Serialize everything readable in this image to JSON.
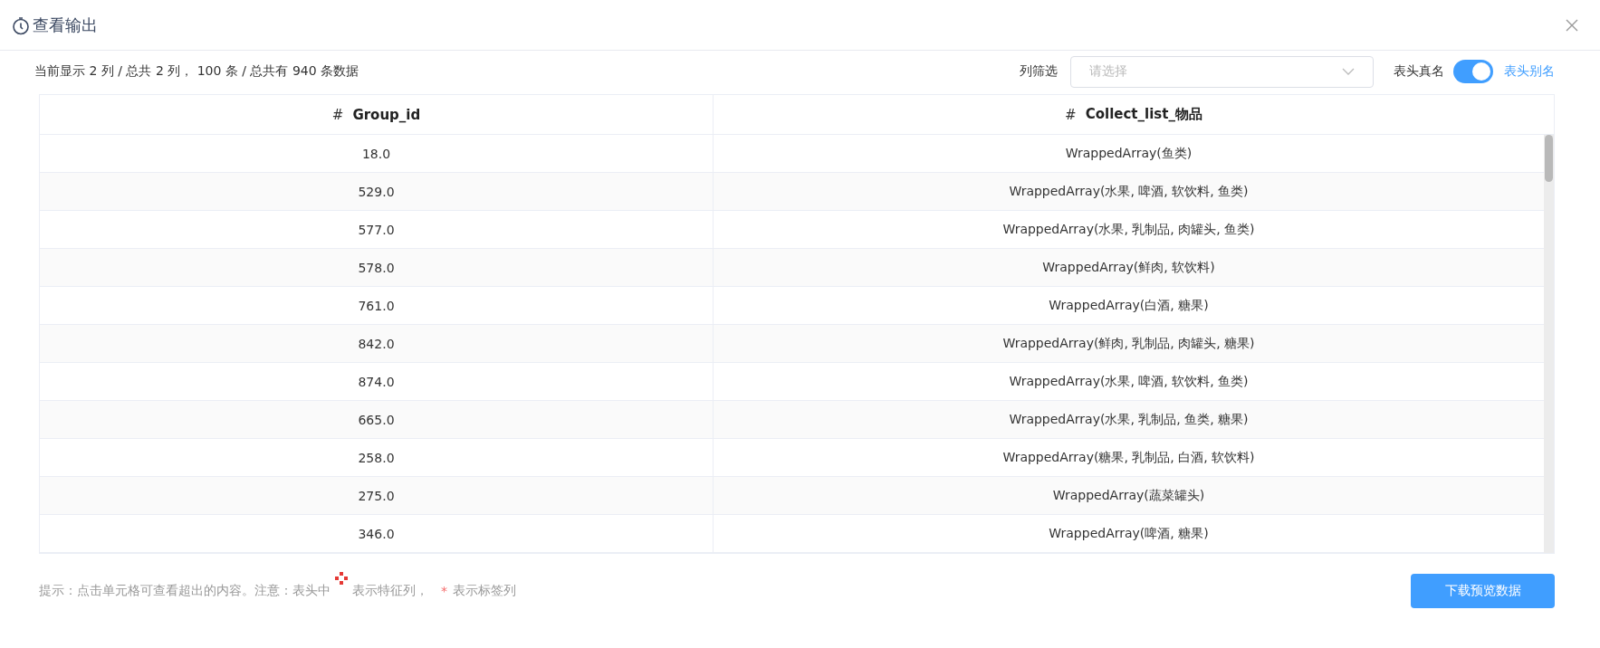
{
  "dialog": {
    "title": "查看输出"
  },
  "summary": "当前显示 2 列 / 总共 2 列， 100 条 / 总共有 940 条数据",
  "column_filter": {
    "label": "列筛选",
    "placeholder": "请选择"
  },
  "header_toggle": {
    "left_label": "表头真名",
    "right_label": "表头别名",
    "on": true
  },
  "table": {
    "columns": [
      {
        "type_mark": "#",
        "name": "Group_id"
      },
      {
        "type_mark": "#",
        "name": "Collect_list_物品"
      }
    ],
    "rows": [
      [
        "18.0",
        "WrappedArray(鱼类)"
      ],
      [
        "529.0",
        "WrappedArray(水果, 啤酒, 软饮料, 鱼类)"
      ],
      [
        "577.0",
        "WrappedArray(水果, 乳制品, 肉罐头, 鱼类)"
      ],
      [
        "578.0",
        "WrappedArray(鲜肉, 软饮料)"
      ],
      [
        "761.0",
        "WrappedArray(白酒, 糖果)"
      ],
      [
        "842.0",
        "WrappedArray(鲜肉, 乳制品, 肉罐头, 糖果)"
      ],
      [
        "874.0",
        "WrappedArray(水果, 啤酒, 软饮料, 鱼类)"
      ],
      [
        "665.0",
        "WrappedArray(水果, 乳制品, 鱼类, 糖果)"
      ],
      [
        "258.0",
        "WrappedArray(糖果, 乳制品, 白酒, 软饮料)"
      ],
      [
        "275.0",
        "WrappedArray(蔬菜罐头)"
      ],
      [
        "346.0",
        "WrappedArray(啤酒, 糖果)"
      ]
    ]
  },
  "hint": {
    "before_icon": "提示：点击单元格可查看超出的内容。注意：表头中",
    "after_icon": "表示特征列，",
    "label_mark": "*",
    "after_mark": "表示标签列"
  },
  "download_button": "下载预览数据"
}
